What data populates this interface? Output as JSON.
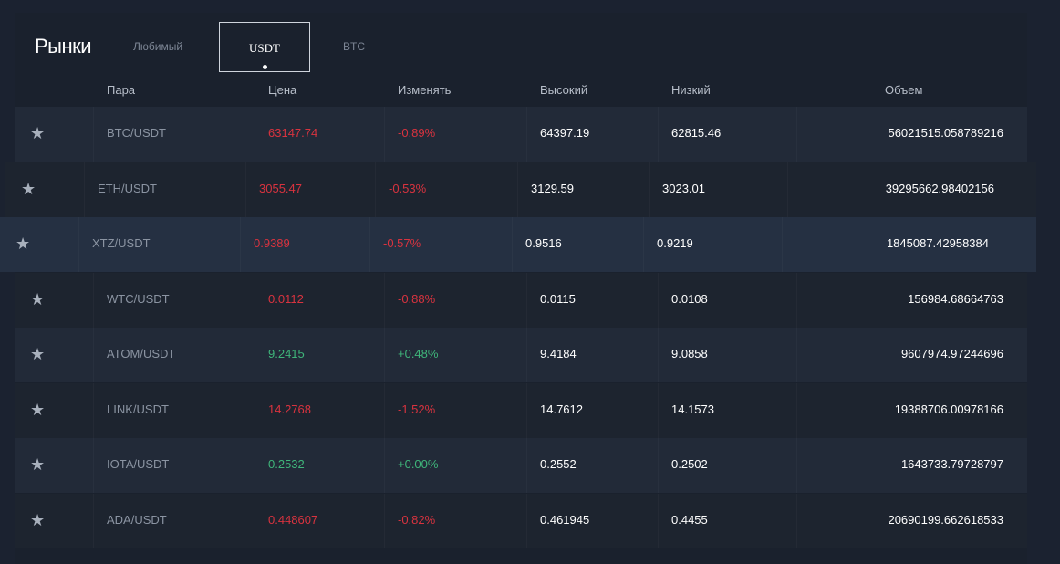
{
  "header": {
    "title": "Рынки",
    "tabs": {
      "favorites": "Любимый",
      "usdt": "USDT",
      "btc": "BTC"
    }
  },
  "columns": {
    "pair": "Пара",
    "price": "Цена",
    "change": "Изменять",
    "high": "Высокий",
    "low": "Низкий",
    "volume": "Объем"
  },
  "colors": {
    "up": "#3fb57a",
    "down": "#d8333f"
  },
  "rows": [
    {
      "pair": "BTC/USDT",
      "price": "63147.74",
      "change": "-0.89%",
      "high": "64397.19",
      "low": "62815.46",
      "volume": "56021515.058789216",
      "trend": "down"
    },
    {
      "pair": "ETH/USDT",
      "price": "3055.47",
      "change": "-0.53%",
      "high": "3129.59",
      "low": "3023.01",
      "volume": "39295662.98402156",
      "trend": "down"
    },
    {
      "pair": "XTZ/USDT",
      "price": "0.9389",
      "change": "-0.57%",
      "high": "0.9516",
      "low": "0.9219",
      "volume": "1845087.42958384",
      "trend": "down"
    },
    {
      "pair": "WTC/USDT",
      "price": "0.0112",
      "change": "-0.88%",
      "high": "0.0115",
      "low": "0.0108",
      "volume": "156984.68664763",
      "trend": "down"
    },
    {
      "pair": "ATOM/USDT",
      "price": "9.2415",
      "change": "+0.48%",
      "high": "9.4184",
      "low": "9.0858",
      "volume": "9607974.97244696",
      "trend": "up"
    },
    {
      "pair": "LINK/USDT",
      "price": "14.2768",
      "change": "-1.52%",
      "high": "14.7612",
      "low": "14.1573",
      "volume": "19388706.00978166",
      "trend": "down"
    },
    {
      "pair": "IOTA/USDT",
      "price": "0.2532",
      "change": "+0.00%",
      "high": "0.2552",
      "low": "0.2502",
      "volume": "1643733.79728797",
      "trend": "up"
    },
    {
      "pair": "ADA/USDT",
      "price": "0.448607",
      "change": "-0.82%",
      "high": "0.461945",
      "low": "0.4455",
      "volume": "20690199.662618533",
      "trend": "down"
    }
  ]
}
